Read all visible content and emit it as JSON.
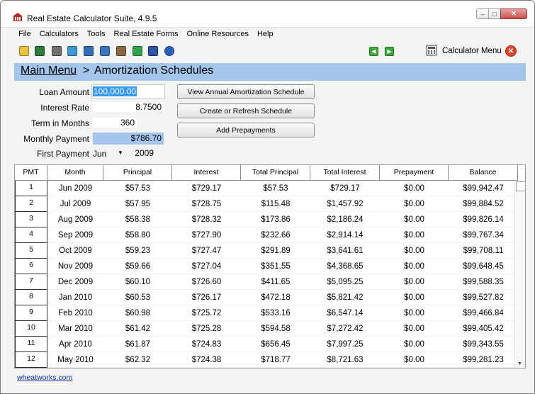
{
  "window": {
    "title": "Real Estate Calculator Suite, 4.9.5",
    "min_glyph": "–",
    "max_glyph": "□",
    "close_glyph": "✕"
  },
  "menu": [
    "File",
    "Calculators",
    "Tools",
    "Real Estate Forms",
    "Online Resources",
    "Help"
  ],
  "toolbar": {
    "icons": [
      {
        "name": "open-folder-icon",
        "color": "#e8c33c"
      },
      {
        "name": "save-icon",
        "color": "#2b7a3b"
      },
      {
        "name": "print-icon",
        "color": "#6e6e6e"
      },
      {
        "name": "refresh-icon",
        "color": "#3c9ad0"
      },
      {
        "name": "monitor-icon",
        "color": "#2f6db5"
      },
      {
        "name": "copy-icon",
        "color": "#3a78c2"
      },
      {
        "name": "clipboard-icon",
        "color": "#8a6a3c"
      },
      {
        "name": "download-icon",
        "color": "#2ea34a"
      },
      {
        "name": "book-icon",
        "color": "#2d56a8"
      },
      {
        "name": "help-icon",
        "color": "#2a5fc0"
      }
    ],
    "back_glyph": "◀",
    "forward_glyph": "▶",
    "calculator_menu_label": "Calculator Menu",
    "close_glyph": "✕"
  },
  "breadcrumb": {
    "main_menu": "Main Menu",
    "separator": ">",
    "page": "Amortization Schedules"
  },
  "form": {
    "loan_amount_label": "Loan Amount",
    "loan_amount_value": "100,000.00",
    "interest_rate_label": "Interest Rate",
    "interest_rate_value": "8.7500",
    "term_label": "Term in Months",
    "term_value": "360",
    "monthly_payment_label": "Monthly Payment",
    "monthly_payment_value": "$786.70",
    "first_payment_label": "First Payment",
    "first_payment_month": "Jun",
    "first_payment_year": "2009"
  },
  "buttons": {
    "view_annual": "View Annual Amortization Schedule",
    "create_refresh": "Create or Refresh Schedule",
    "add_prepayments": "Add Prepayments"
  },
  "table": {
    "columns": [
      "PMT",
      "Month",
      "Principal",
      "Interest",
      "Total Principal",
      "Total Interest",
      "Prepayment",
      "Balance"
    ],
    "rows": [
      [
        "1",
        "Jun 2009",
        "$57.53",
        "$729.17",
        "$57.53",
        "$729.17",
        "$0.00",
        "$99,942.47"
      ],
      [
        "2",
        "Jul 2009",
        "$57.95",
        "$728.75",
        "$115.48",
        "$1,457.92",
        "$0.00",
        "$99,884.52"
      ],
      [
        "3",
        "Aug 2009",
        "$58.38",
        "$728.32",
        "$173.86",
        "$2,186.24",
        "$0.00",
        "$99,826.14"
      ],
      [
        "4",
        "Sep 2009",
        "$58.80",
        "$727.90",
        "$232.66",
        "$2,914.14",
        "$0.00",
        "$99,767.34"
      ],
      [
        "5",
        "Oct 2009",
        "$59.23",
        "$727.47",
        "$291.89",
        "$3,641.61",
        "$0.00",
        "$99,708.11"
      ],
      [
        "6",
        "Nov 2009",
        "$59.66",
        "$727.04",
        "$351.55",
        "$4,368.65",
        "$0.00",
        "$99,648.45"
      ],
      [
        "7",
        "Dec 2009",
        "$60.10",
        "$726.60",
        "$411.65",
        "$5,095.25",
        "$0.00",
        "$99,588.35"
      ],
      [
        "8",
        "Jan 2010",
        "$60.53",
        "$726.17",
        "$472.18",
        "$5,821.42",
        "$0.00",
        "$99,527.82"
      ],
      [
        "9",
        "Feb 2010",
        "$60.98",
        "$725.72",
        "$533.16",
        "$6,547.14",
        "$0.00",
        "$99,466.84"
      ],
      [
        "10",
        "Mar 2010",
        "$61.42",
        "$725.28",
        "$594.58",
        "$7,272.42",
        "$0.00",
        "$99,405.42"
      ],
      [
        "11",
        "Apr 2010",
        "$61.87",
        "$724.83",
        "$656.45",
        "$7,997.25",
        "$0.00",
        "$99,343.55"
      ],
      [
        "12",
        "May 2010",
        "$62.32",
        "$724.38",
        "$718.77",
        "$8,721.63",
        "$0.00",
        "$99,281.23"
      ]
    ]
  },
  "footer": {
    "link": "wheatworks.com"
  }
}
